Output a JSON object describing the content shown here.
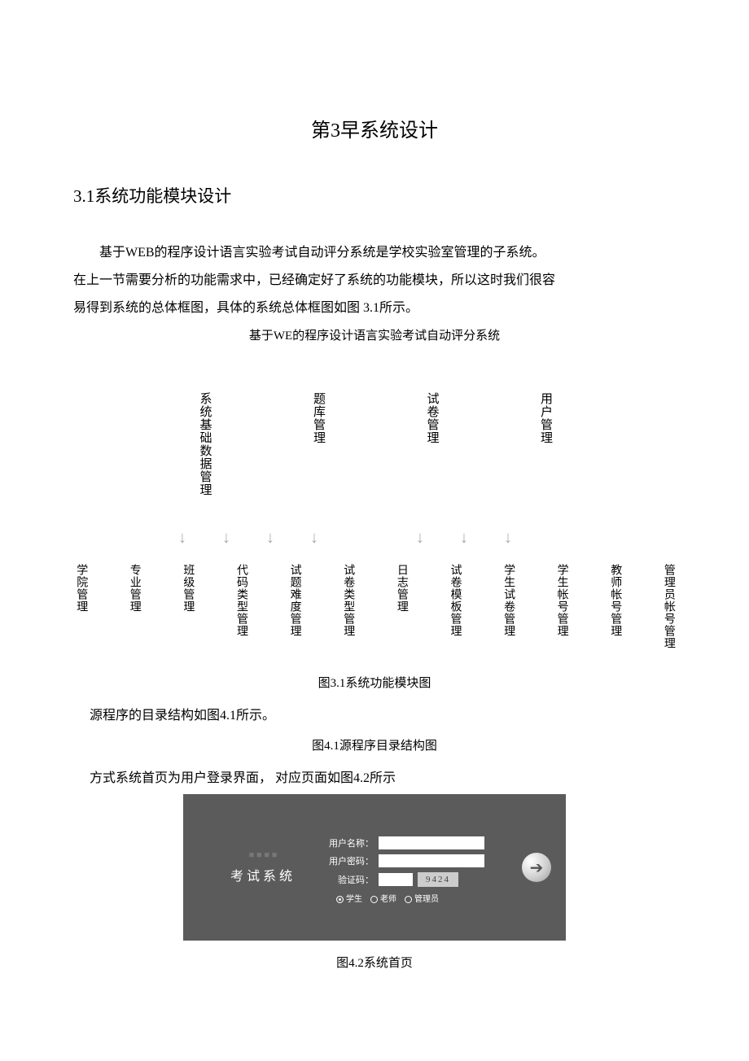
{
  "chapter_title": "第3早系统设计",
  "section_title": "3.1系统功能模块设计",
  "paragraphs": {
    "p1": "基于WEB的程序设计语言实验考试自动评分系统是学校实验室管理的子系统。",
    "p2": "在上一节需要分析的功能需求中，已经确定好了系统的功能模块，所以这时我们很容",
    "p3": "易得到系统的总体框图，具体的系统总体框图如图 3.1所示。"
  },
  "diagram": {
    "root": "基于WE的程序设计语言实验考试自动评分系统",
    "tier1": [
      "系统基础数据管理",
      "题库管理",
      "试卷管理",
      "用户管理"
    ],
    "tier2": [
      "学院管理",
      "专业管理",
      "班级管理",
      "代码类型管理",
      "试题难度管理",
      "试卷类型管理",
      "日志管理",
      "试卷模板管理",
      "学生试卷管理",
      "学生帐号管理",
      "教师帐号管理",
      "管理员帐号管理"
    ],
    "caption": "图3.1系统功能模块图"
  },
  "source_struct": {
    "line": "源程序的目录结构如图4.1所示。",
    "caption": "图4.1源程序目录结构图"
  },
  "homepage": {
    "line": "方式系统首页为用户登录界面， 对应页面如图4.2所示",
    "caption": "图4.2系统首页"
  },
  "login": {
    "brand_faded": "■ ■ ■ ■",
    "brand": "考试系统",
    "username_label": "用户名称：",
    "password_label": "用户密码：",
    "captcha_label": "验证码：",
    "captcha_value": "9424",
    "role_student": "学生",
    "role_teacher": "老师",
    "role_admin": "管理员"
  }
}
